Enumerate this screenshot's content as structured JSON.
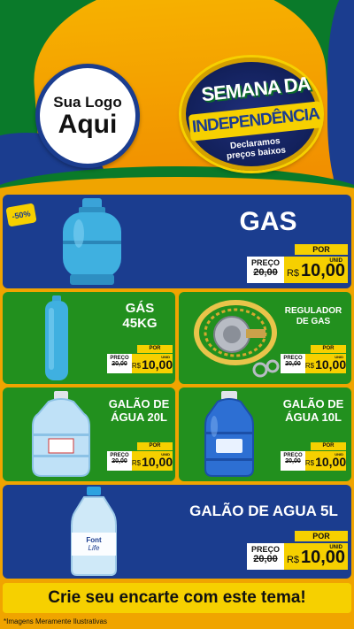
{
  "logo": {
    "line1": "Sua Logo",
    "line2": "Aqui"
  },
  "seal": {
    "line1": "SEMANA DA",
    "line2": "INDEPENDÊNCIA",
    "sub1": "Declaramos",
    "sub2": "preços baixos"
  },
  "discount_badge": "-50%",
  "price_tag": {
    "por": "POR",
    "preco": "PREÇO",
    "old_price": "20,00",
    "currency": "R$",
    "new_price": "10,00",
    "unit": "UNID"
  },
  "products": [
    {
      "title": "GAS",
      "icon": "gas-cylinder-13kg"
    },
    {
      "title_line1": "GÁS",
      "title_line2": "45KG",
      "icon": "gas-cylinder-45kg"
    },
    {
      "title_line1": "REGULADOR",
      "title_line2": "DE GAS",
      "icon": "gas-regulator"
    },
    {
      "title_line1": "GALÃO DE",
      "title_line2": "ÁGUA 20L",
      "icon": "water-jug-20l"
    },
    {
      "title_line1": "GALÃO DE",
      "title_line2": "ÁGUA 10L",
      "icon": "water-jug-10l"
    },
    {
      "title": "GALÃO DE AGUA 5L",
      "icon": "water-bottle-5l",
      "brand_line1": "Font",
      "brand_line2": "Life"
    }
  ],
  "cta": "Crie seu encarte com este tema!",
  "footer": "*Imagens Meramente Ilustrativas",
  "colors": {
    "blue": "#1b3d8f",
    "green": "#22901e",
    "yellow": "#f6d000",
    "orange": "#f0a400"
  }
}
